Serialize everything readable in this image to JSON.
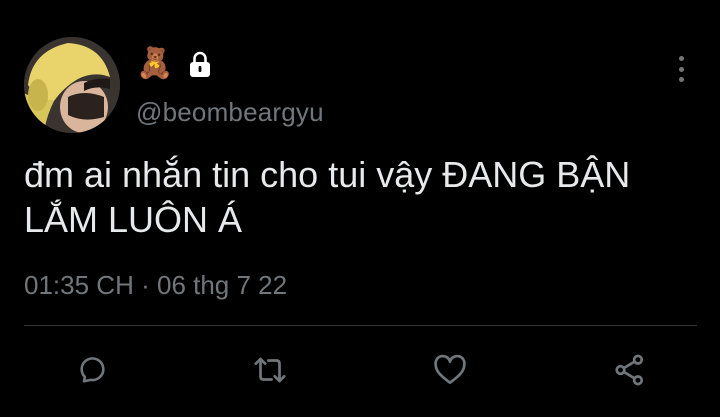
{
  "profile": {
    "handle": "@beombeargyu",
    "display_name_emoji": "🧸",
    "avatar_icon": "user-avatar",
    "protected_icon": "lock-icon"
  },
  "tweet": {
    "text": "đm ai nhắn tin cho tui vậy ĐANG BẬN\nLẮM LUÔN Á",
    "time": "01:35 CH",
    "separator": "·",
    "date": "06 thg 7 22"
  },
  "actions": [
    {
      "icon": "reply-icon"
    },
    {
      "icon": "retweet-icon"
    },
    {
      "icon": "like-icon"
    },
    {
      "icon": "share-icon"
    }
  ],
  "menu": {
    "icon": "more-vertical-icon"
  },
  "colors": {
    "background": "#000000",
    "text": "#e7e9ea",
    "secondary_text": "#71767b",
    "divider": "#2f3336"
  }
}
